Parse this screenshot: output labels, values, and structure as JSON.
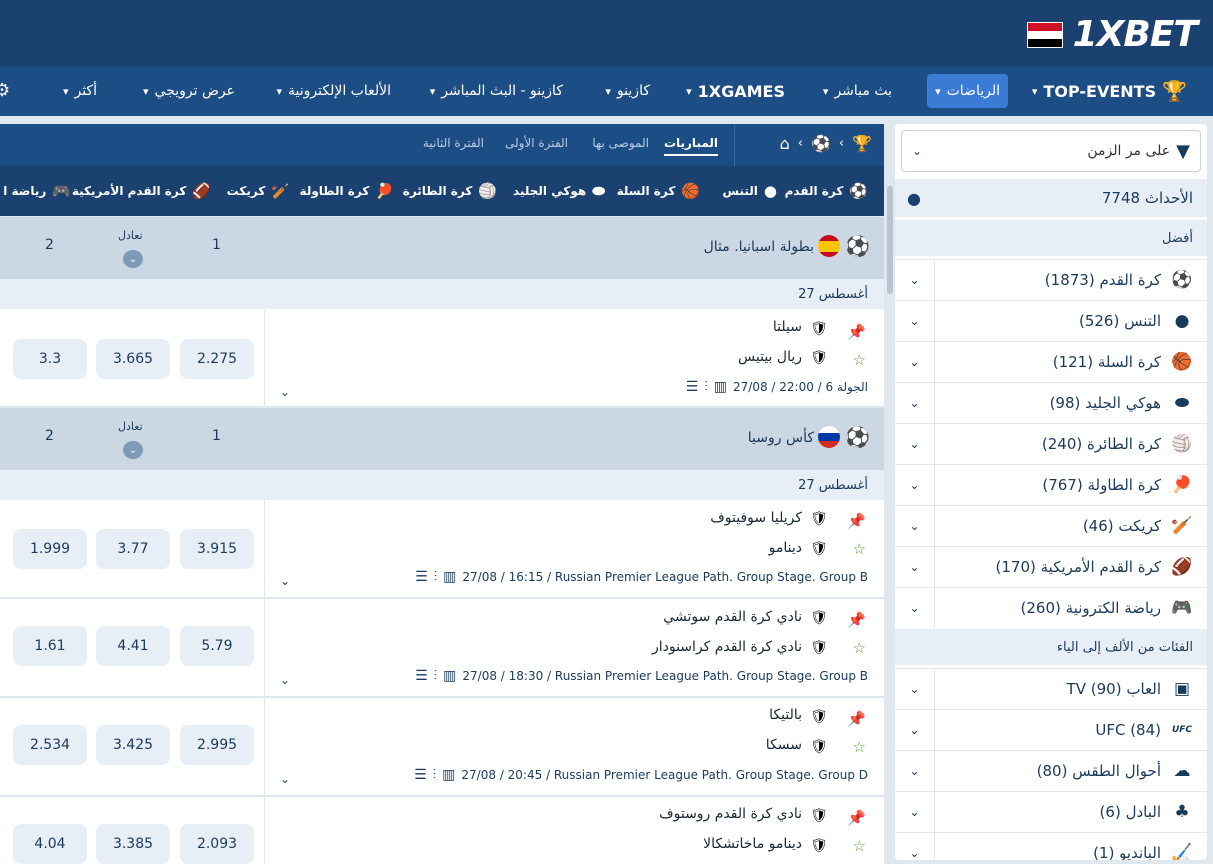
{
  "brand": {
    "logo_text": "1XBET",
    "flag_colors": [
      "#ce1126",
      "#ffffff",
      "#000000"
    ]
  },
  "nav": {
    "items": [
      {
        "label": "TOP-EVENTS",
        "icon": "trophy-icon"
      },
      {
        "label": "الرياضات",
        "active": true
      },
      {
        "label": "بث مباشر"
      },
      {
        "label": "1XGAMES"
      },
      {
        "label": "كازينو"
      },
      {
        "label": "كازينو - البث المباشر"
      },
      {
        "label": "الألعاب الإلكترونية"
      },
      {
        "label": "عرض ترويجي"
      },
      {
        "label": "أكثر"
      }
    ]
  },
  "main": {
    "tabs": [
      {
        "label": "المباريات",
        "active": true
      },
      {
        "label": "الموصى بها"
      },
      {
        "label": "الفترة الأولى"
      },
      {
        "label": "الفترة الثانية"
      }
    ],
    "sports": [
      {
        "label": "كرة القدم",
        "icon": "soccer-icon"
      },
      {
        "label": "التنس",
        "icon": "tennis-icon"
      },
      {
        "label": "كرة السلة",
        "icon": "basketball-icon"
      },
      {
        "label": "هوكي الجليد",
        "icon": "hockey-puck-icon"
      },
      {
        "label": "كرة الطائرة",
        "icon": "volleyball-icon"
      },
      {
        "label": "كرة الطاولة",
        "icon": "table-tennis-icon"
      },
      {
        "label": "كريكت",
        "icon": "cricket-icon"
      },
      {
        "label": "كرة القدم الأمريكية",
        "icon": "american-football-icon"
      },
      {
        "label": "رياضة ا",
        "icon": "gamepad-icon"
      }
    ],
    "leagues": [
      {
        "name": "بطولة اسبانيا. مثال",
        "flag_colors": [
          "#c60b1e",
          "#ffc400",
          "#c60b1e"
        ],
        "h1": "1",
        "hx": "تعادل",
        "h2": "2",
        "date": "27 أغسطس",
        "matches": [
          {
            "team1": "سيلتا",
            "team2": "ريال بيتيس",
            "info": "27/08 / 22:00 / الجولة 6",
            "odds": [
              "2.275",
              "3.665",
              "3.3"
            ]
          }
        ]
      },
      {
        "name": "كأس روسيا",
        "flag_colors": [
          "#ffffff",
          "#0039a6",
          "#d52b1e"
        ],
        "h1": "1",
        "hx": "تعادل",
        "h2": "2",
        "date": "27 أغسطس",
        "matches": [
          {
            "team1": "كريليا سوفيتوف",
            "team2": "دينامو",
            "info": "27/08 / 16:15 / Russian Premier League Path. Group Stage. Group B",
            "odds": [
              "3.915",
              "3.77",
              "1.999"
            ]
          },
          {
            "team1": "نادي كرة القدم سوتشي",
            "team2": "نادي كرة القدم كراسنودار",
            "info": "27/08 / 18:30 / Russian Premier League Path. Group Stage. Group B",
            "odds": [
              "5.79",
              "4.41",
              "1.61"
            ]
          },
          {
            "team1": "بالتيكا",
            "team2": "سسكا",
            "info": "27/08 / 20:45 / Russian Premier League Path. Group Stage. Group D",
            "odds": [
              "2.995",
              "3.425",
              "2.534"
            ]
          },
          {
            "team1": "نادي كرة القدم روستوف",
            "team2": "دينامو ماخاتشكالا",
            "info": "",
            "odds": [
              "2.093",
              "3.385",
              "4.04"
            ]
          }
        ]
      }
    ]
  },
  "sidebar": {
    "filter_label": "على مر الزمن",
    "events_label": "7748 الأحداث",
    "best_title": "أفضل",
    "best": [
      {
        "label": "كرة القدم (1873)",
        "icon": "soccer-icon"
      },
      {
        "label": "التنس (526)",
        "icon": "tennis-icon"
      },
      {
        "label": "كرة السلة (121)",
        "icon": "basketball-icon"
      },
      {
        "label": "هوكي الجليد (98)",
        "icon": "hockey-puck-icon"
      },
      {
        "label": "كرة الطائرة (240)",
        "icon": "volleyball-icon"
      },
      {
        "label": "كرة الطاولة (767)",
        "icon": "table-tennis-icon"
      },
      {
        "label": "كريكت (46)",
        "icon": "cricket-icon"
      },
      {
        "label": "كرة القدم الأمريكية (170)",
        "icon": "american-football-icon"
      },
      {
        "label": "رياضة الكترونية (260)",
        "icon": "gamepad-icon"
      }
    ],
    "az_title": "الفئات من الألف إلى الياء",
    "az": [
      {
        "label": "TV العاب (90)",
        "icon": "tv-games-icon"
      },
      {
        "label": "UFC (84)",
        "icon": "ufc-icon"
      },
      {
        "label": "أحوال الطقس (80)",
        "icon": "cloud-icon"
      },
      {
        "label": "البادل (6)",
        "icon": "padel-icon"
      },
      {
        "label": "البانديو (1)",
        "icon": "bandy-icon"
      }
    ]
  }
}
